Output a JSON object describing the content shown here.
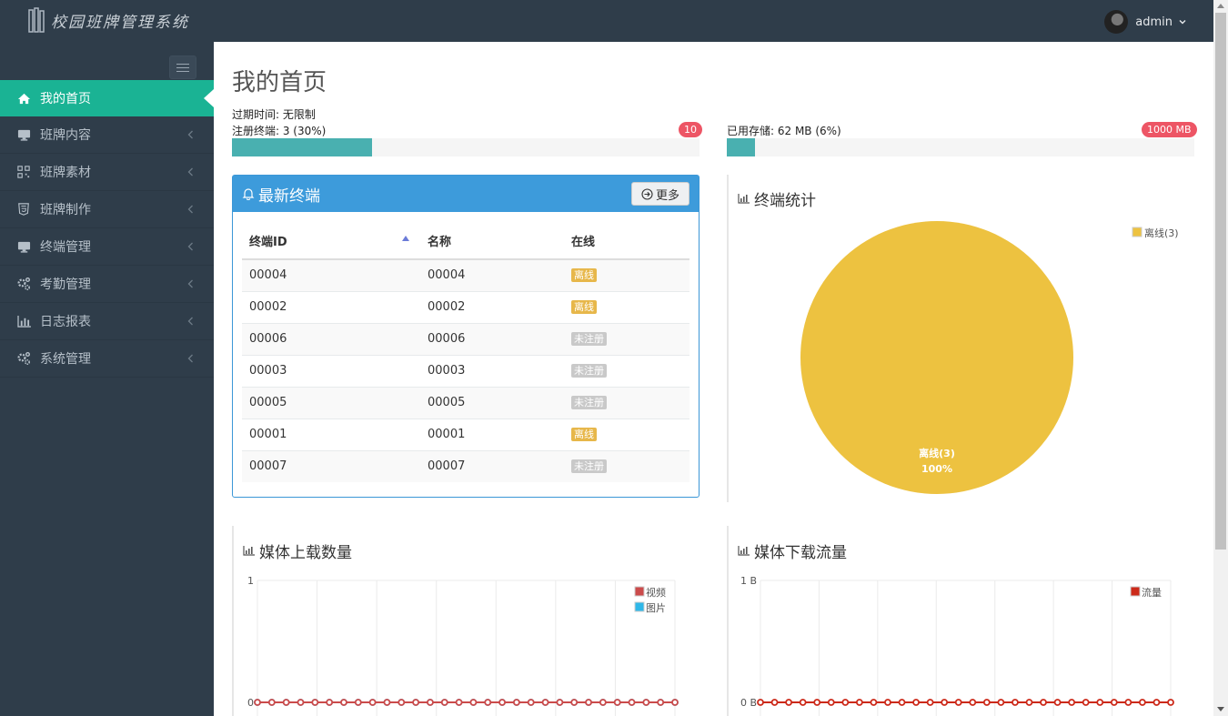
{
  "app": {
    "title": "校园班牌管理系统"
  },
  "user": {
    "name": "admin"
  },
  "sidebar": {
    "items": [
      {
        "label": "我的首页",
        "icon": "home-icon",
        "active": true
      },
      {
        "label": "班牌内容",
        "icon": "desktop-icon"
      },
      {
        "label": "班牌素材",
        "icon": "qrcode-icon"
      },
      {
        "label": "班牌制作",
        "icon": "html5-icon"
      },
      {
        "label": "终端管理",
        "icon": "desktop-icon"
      },
      {
        "label": "考勤管理",
        "icon": "gears-icon"
      },
      {
        "label": "日志报表",
        "icon": "bar-chart-icon"
      },
      {
        "label": "系统管理",
        "icon": "gears-icon"
      }
    ]
  },
  "main": {
    "title": "我的首页",
    "expire": "过期时间: 无限制",
    "terminals": {
      "label": "注册终端: 3 (30%)",
      "badge": "10",
      "percent": 30
    },
    "storage": {
      "label": "已用存储: 62 MB (6%)",
      "badge": "1000 MB",
      "percent": 6
    }
  },
  "latest": {
    "title": "最新终端",
    "more": "更多",
    "columns": [
      "终端ID",
      "名称",
      "在线"
    ],
    "rows": [
      {
        "id": "00004",
        "name": "00004",
        "status": "离线",
        "status_type": "offline"
      },
      {
        "id": "00002",
        "name": "00002",
        "status": "离线",
        "status_type": "offline"
      },
      {
        "id": "00006",
        "name": "00006",
        "status": "未注册",
        "status_type": "unregistered"
      },
      {
        "id": "00003",
        "name": "00003",
        "status": "未注册",
        "status_type": "unregistered"
      },
      {
        "id": "00005",
        "name": "00005",
        "status": "未注册",
        "status_type": "unregistered"
      },
      {
        "id": "00001",
        "name": "00001",
        "status": "离线",
        "status_type": "offline"
      },
      {
        "id": "00007",
        "name": "00007",
        "status": "未注册",
        "status_type": "unregistered"
      }
    ]
  },
  "chart_data": [
    {
      "type": "pie",
      "title": "终端统计",
      "legend": [
        "离线(3)"
      ],
      "slices": [
        {
          "label": "离线(3)",
          "value": 3,
          "percent": "100%",
          "color": "#edc240"
        }
      ]
    },
    {
      "type": "line",
      "title": "媒体上载数量",
      "ylim": [
        0,
        1
      ],
      "yticks": [
        "0",
        "1"
      ],
      "points": 30,
      "series": [
        {
          "name": "视频",
          "color": "#cb4b4b",
          "values": [
            0,
            0,
            0,
            0,
            0,
            0,
            0,
            0,
            0,
            0,
            0,
            0,
            0,
            0,
            0,
            0,
            0,
            0,
            0,
            0,
            0,
            0,
            0,
            0,
            0,
            0,
            0,
            0,
            0,
            0
          ]
        },
        {
          "name": "图片",
          "color": "#2fb7e8",
          "values": [
            0,
            0,
            0,
            0,
            0,
            0,
            0,
            0,
            0,
            0,
            0,
            0,
            0,
            0,
            0,
            0,
            0,
            0,
            0,
            0,
            0,
            0,
            0,
            0,
            0,
            0,
            0,
            0,
            0,
            0
          ]
        }
      ]
    },
    {
      "type": "line",
      "title": "媒体下载流量",
      "ylim": [
        0,
        1
      ],
      "yticks": [
        "0 B",
        "1 B"
      ],
      "points": 30,
      "series": [
        {
          "name": "流量",
          "color": "#cc2a1a",
          "values": [
            0,
            0,
            0,
            0,
            0,
            0,
            0,
            0,
            0,
            0,
            0,
            0,
            0,
            0,
            0,
            0,
            0,
            0,
            0,
            0,
            0,
            0,
            0,
            0,
            0,
            0,
            0,
            0,
            0,
            0
          ]
        }
      ]
    }
  ]
}
